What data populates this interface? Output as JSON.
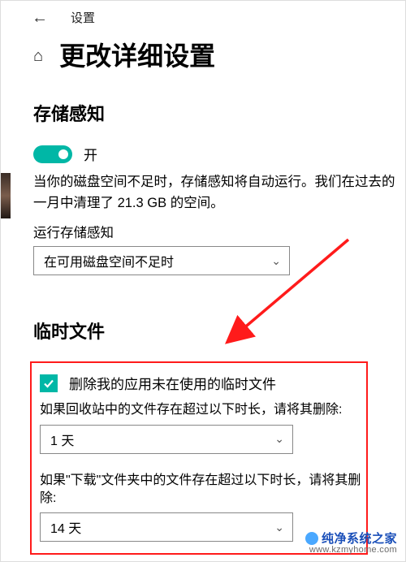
{
  "top": {
    "back_glyph": "←",
    "settings_label": "设置"
  },
  "header": {
    "home_glyph": "⌂",
    "title": "更改详细设置"
  },
  "storage_sense": {
    "section_title": "存储感知",
    "toggle_state": "开",
    "description": "当你的磁盘空间不足时，存储感知将自动运行。我们在过去的一月中清理了 21.3 GB 的空间。",
    "run_label": "运行存储感知",
    "run_selected": "在可用磁盘空间不足时"
  },
  "temp_files": {
    "section_title": "临时文件",
    "checkbox_label": "删除我的应用未在使用的临时文件",
    "recycle_label": "如果回收站中的文件存在超过以下时长，请将其删除:",
    "recycle_selected": "1 天",
    "downloads_label": "如果\"下载\"文件夹中的文件存在超过以下时长，请将其删除:",
    "downloads_selected": "14 天"
  },
  "watermark": {
    "title": "纯净系统之家",
    "url": "www.kzmyhome.com"
  },
  "chevron": "⌄"
}
